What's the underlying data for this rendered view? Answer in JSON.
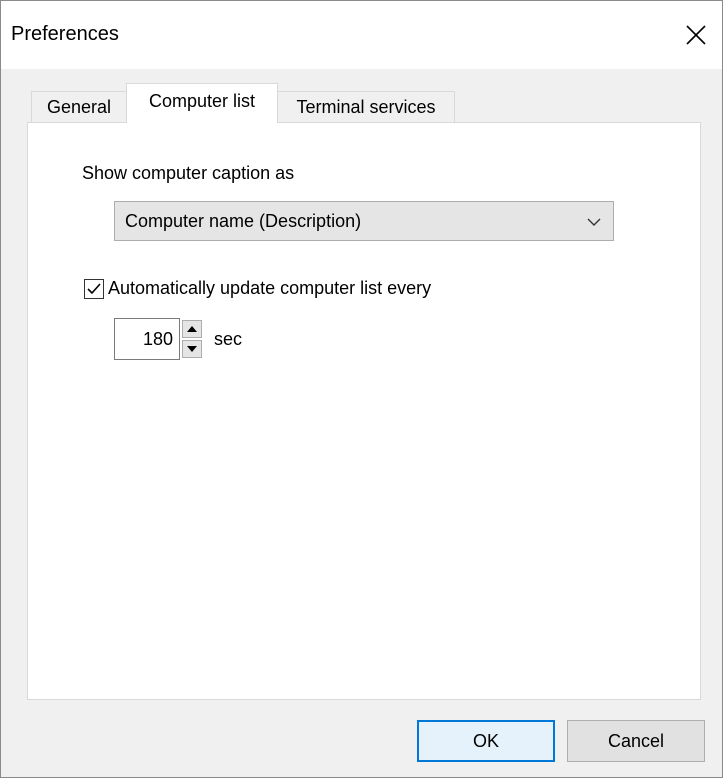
{
  "window": {
    "title": "Preferences",
    "close_icon": "close-icon"
  },
  "tabs": [
    {
      "label": "General",
      "active": false
    },
    {
      "label": "Computer list",
      "active": true
    },
    {
      "label": "Terminal services",
      "active": false
    }
  ],
  "computer_list": {
    "caption_label": "Show computer caption as",
    "caption_dropdown": {
      "selected": "Computer name (Description)"
    },
    "auto_update": {
      "checked": true,
      "label": "Automatically update computer list every"
    },
    "interval": {
      "value": "180",
      "unit": "sec"
    }
  },
  "buttons": {
    "ok": "OK",
    "cancel": "Cancel"
  },
  "colors": {
    "accent": "#0078d7",
    "window_bg": "#f0f0f0",
    "panel_bg": "#ffffff"
  }
}
